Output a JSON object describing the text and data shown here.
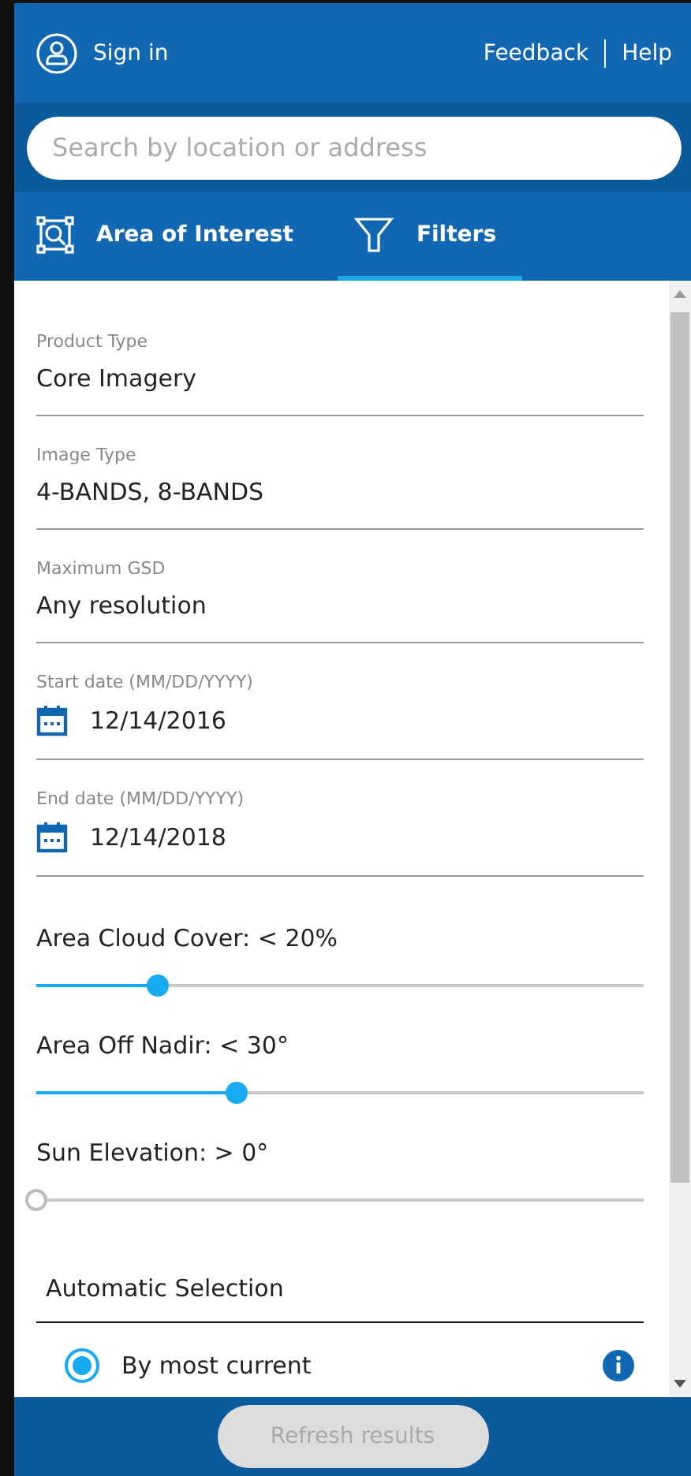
{
  "header": {
    "sign_in": "Sign in",
    "links": [
      "Feedback",
      "Help"
    ]
  },
  "search": {
    "placeholder": "Search by location or address"
  },
  "tabs": [
    {
      "label": "Area of Interest",
      "kind": "aoi",
      "selected": false
    },
    {
      "label": "Filters",
      "kind": "filter",
      "selected": true
    }
  ],
  "fields": [
    {
      "label": "Product Type",
      "value": "Core Imagery",
      "kind": "text"
    },
    {
      "label": "Image Type",
      "value": "4-BANDS, 8-BANDS",
      "kind": "text"
    },
    {
      "label": "Maximum GSD",
      "value": "Any resolution",
      "kind": "text"
    },
    {
      "label": "Start date (MM/DD/YYYY)",
      "value": "12/14/2016",
      "kind": "date"
    },
    {
      "label": "End date (MM/DD/YYYY)",
      "value": "12/14/2018",
      "kind": "date"
    }
  ],
  "sliders": [
    {
      "label": "Area Cloud Cover: < 20%",
      "level": 0.2
    },
    {
      "label": "Area Off Nadir: < 30°",
      "level": 0.33
    },
    {
      "label": "Sun Elevation: > 0°",
      "level": 0
    }
  ],
  "automatic_selection": {
    "title": "Automatic Selection",
    "options": [
      {
        "label": "By most current",
        "selected": true
      }
    ]
  },
  "footer": {
    "button": "Refresh results",
    "disabled": true
  }
}
